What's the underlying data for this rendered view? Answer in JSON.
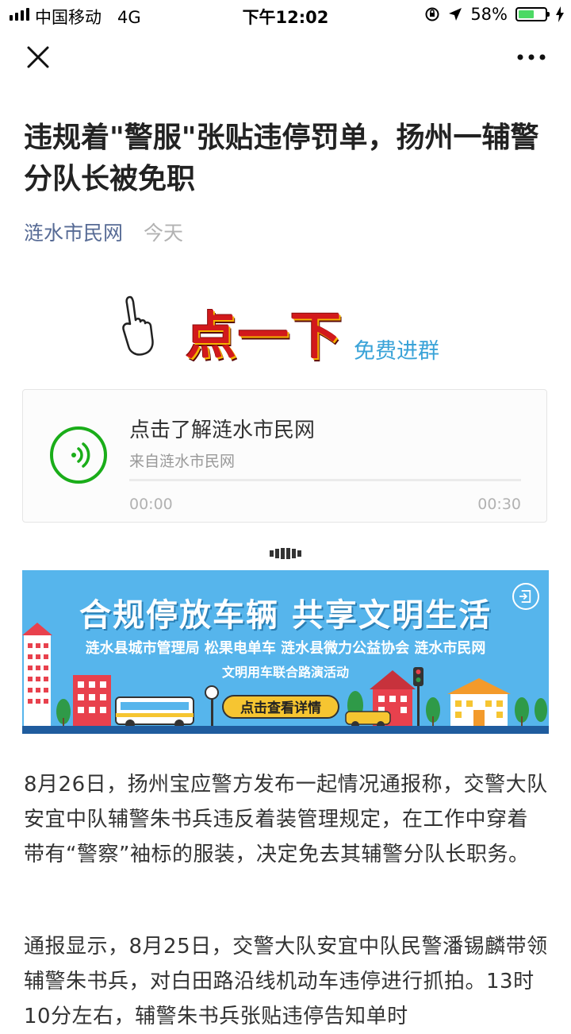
{
  "status_bar": {
    "carrier": "中国移动",
    "network": "4G",
    "time": "下午12:02",
    "battery_percent": "58%",
    "battery_level": 0.58
  },
  "nav": {
    "close_icon": "close-icon",
    "more_icon": "more-icon"
  },
  "article": {
    "title": "违规着\"警服\"张贴违停罚单，扬州一辅警分队长被免职",
    "source": "涟水市民网",
    "date": "今天"
  },
  "click_banner": {
    "big_text": "点一下",
    "small_text": "免费进群"
  },
  "audio": {
    "title": "点击了解涟水市民网",
    "from": "来自涟水市民网",
    "current_time": "00:00",
    "duration": "00:30",
    "progress": 0
  },
  "ad_banner": {
    "headline": "合规停放车辆  共享文明生活",
    "orgs": "涟水县城市管理局  松果电单车  涟水县微力公益协会  涟水市民网",
    "event": "文明用车联合路演活动",
    "cta": "点击查看详情"
  },
  "paragraphs": [
    "8月26日，扬州宝应警方发布一起情况通报称，交警大队安宜中队辅警朱书兵违反着装管理规定，在工作中穿着带有“警察”袖标的服装，决定免去其辅警分队长职务。",
    "通报显示，8月25日，交警大队安宜中队民警潘锡麟带领辅警朱书兵，对白田路沿线机动车违停进行抓拍。13时10分左右，辅警朱书兵张贴违停告知单时"
  ],
  "colors": {
    "link": "#576b95",
    "play_green": "#1aad19",
    "banner_blue": "#56b5ec",
    "cta_yellow": "#f6c531"
  }
}
